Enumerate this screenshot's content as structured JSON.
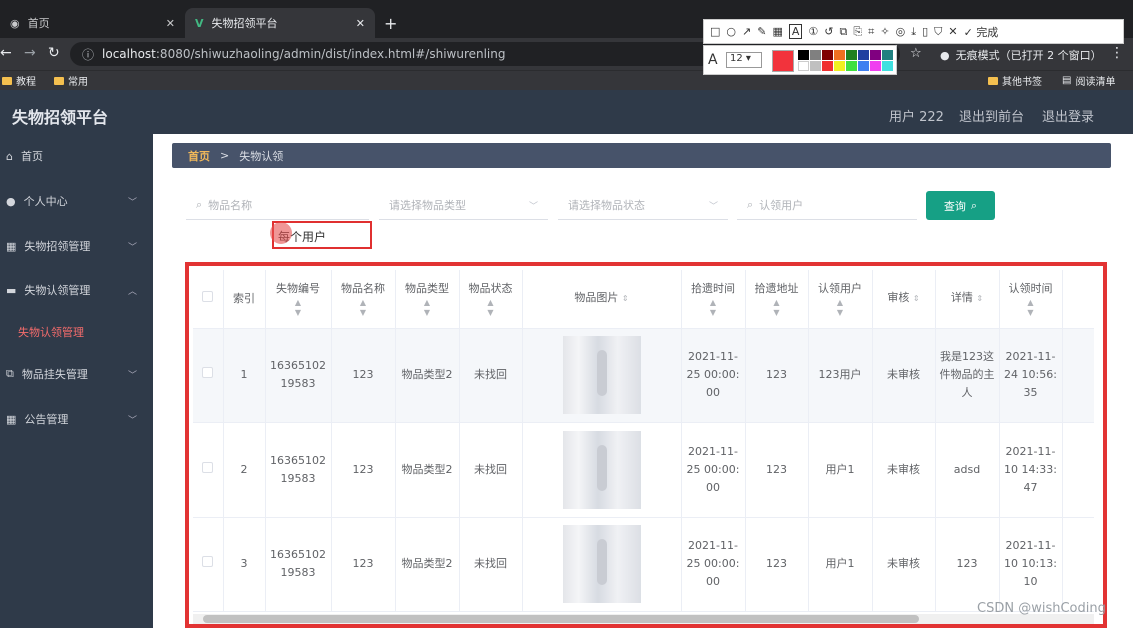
{
  "browser": {
    "tabs": [
      {
        "title": "首页"
      },
      {
        "title": "失物招领平台"
      }
    ],
    "new_tab": "+",
    "url_host": "localhost",
    "url_rest": ":8080/shiwuzhaoling/admin/dist/index.html#/shiwurenling",
    "incognito": "无痕模式（已打开 2 个窗口）",
    "bookmarks": [
      "教程",
      "常用"
    ],
    "bookmarks_right": [
      "其他书签",
      "阅读清单"
    ]
  },
  "annotation_toolbar": {
    "done_label": "完成",
    "font_size": "12",
    "active_color": "#f2333c"
  },
  "app": {
    "brand": "失物招领平台",
    "user": "用户 222",
    "to_front": "退出到前台",
    "logout": "退出登录"
  },
  "sidebar": {
    "items": [
      {
        "label": "首页",
        "icon": "home-icon"
      },
      {
        "label": "个人中心",
        "icon": "user-icon"
      },
      {
        "label": "失物招领管理",
        "icon": "grid-icon"
      },
      {
        "label": "失物认领管理",
        "icon": "monitor-icon"
      },
      {
        "label": "失物认领管理",
        "icon": "submenu"
      },
      {
        "label": "物品挂失管理",
        "icon": "copy-icon"
      },
      {
        "label": "公告管理",
        "icon": "grid-icon"
      }
    ]
  },
  "breadcrumb": {
    "home": "首页",
    "sep": ">",
    "current": "失物认领"
  },
  "filters": {
    "name_placeholder": "物品名称",
    "type_placeholder": "请选择物品类型",
    "status_placeholder": "请选择物品状态",
    "user_placeholder": "认领用户",
    "query_label": "查询"
  },
  "annotation_text": "每个用户",
  "table": {
    "headers": [
      "",
      "索引",
      "失物编号",
      "物品名称",
      "物品类型",
      "物品状态",
      "物品图片",
      "拾遗时间",
      "拾遗地址",
      "认领用户",
      "审核",
      "详情",
      "认领时间",
      ""
    ],
    "rows": [
      {
        "index": "1",
        "code": "1636510219583",
        "name": "123",
        "type": "物品类型2",
        "status": "未找回",
        "time": "2021-11-25 00:00:00",
        "addr": "123",
        "user": "123用户",
        "audit": "未审核",
        "detail": "我是123这件物品的主人",
        "claim_time": "2021-11-24 10:56:35"
      },
      {
        "index": "2",
        "code": "1636510219583",
        "name": "123",
        "type": "物品类型2",
        "status": "未找回",
        "time": "2021-11-25 00:00:00",
        "addr": "123",
        "user": "用户1",
        "audit": "未审核",
        "detail": "adsd",
        "claim_time": "2021-11-10 14:33:47"
      },
      {
        "index": "3",
        "code": "1636510219583",
        "name": "123",
        "type": "物品类型2",
        "status": "未找回",
        "time": "2021-11-25 00:00:00",
        "addr": "123",
        "user": "用户1",
        "audit": "未审核",
        "detail": "123",
        "claim_time": "2021-11-10 10:13:10"
      }
    ]
  },
  "watermark": "CSDN @wishCoding",
  "colors": {
    "header": "#2f3a49",
    "accent": "#16a085",
    "highlight": "#e23333",
    "breadcrumb_home": "#f0b85a"
  }
}
